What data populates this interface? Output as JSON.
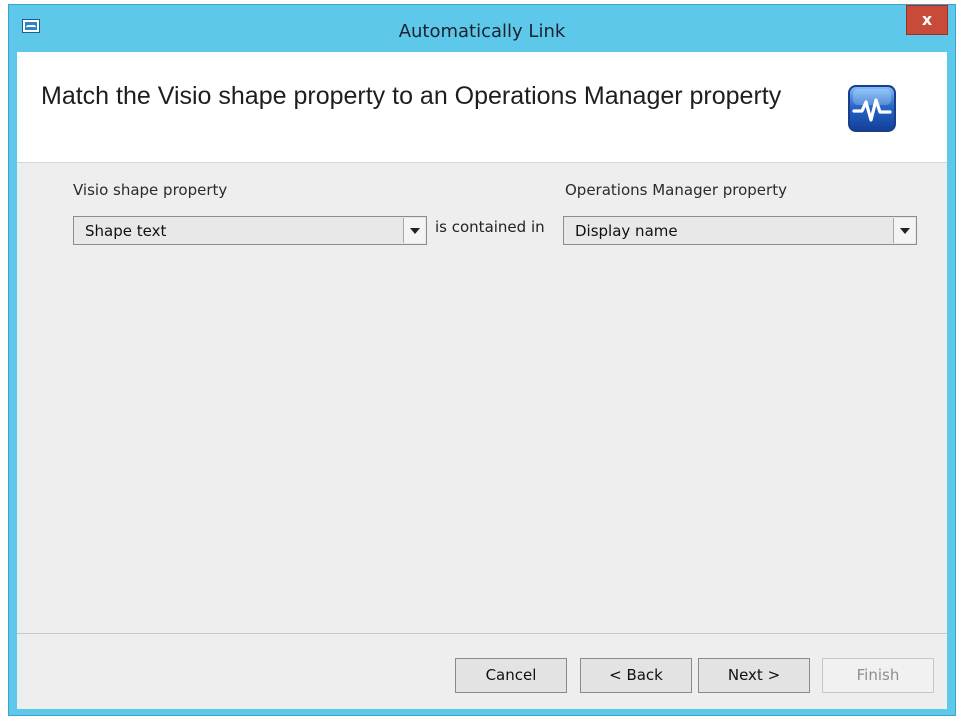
{
  "window": {
    "title": "Automatically Link",
    "close_label": "x"
  },
  "header": {
    "title": "Match the Visio shape property to an Operations Manager property"
  },
  "form": {
    "left_label": "Visio shape property",
    "right_label": "Operations Manager property",
    "left_value": "Shape text",
    "connector": "is contained in",
    "right_value": "Display name"
  },
  "buttons": {
    "cancel": "Cancel",
    "back": "< Back",
    "next": "Next >",
    "finish": "Finish"
  },
  "colors": {
    "titlebar": "#5ec8ea",
    "close_button": "#c84b39",
    "panel": "#eeeeee"
  }
}
